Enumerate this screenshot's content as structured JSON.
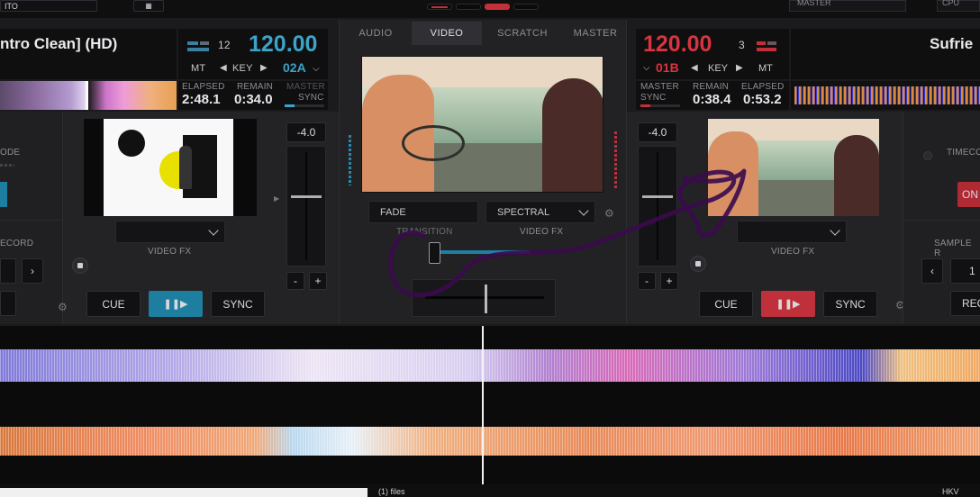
{
  "top_bar": {
    "left_label": "ITO",
    "right_master_label": "MASTER",
    "right_cpu_label": "CPU"
  },
  "left_deck": {
    "title": "ntro Clean] (HD)",
    "bpm": "120.00",
    "beat_count": "12",
    "key": "02A",
    "mt_label": "MT",
    "key_label": "KEY",
    "elapsed_label": "ELAPSED",
    "remain_label": "REMAIN",
    "master_label": "MASTER",
    "sync_label": "SYNC",
    "elapsed": "2:48.1",
    "remain": "0:34.0",
    "mode_label": "ODE",
    "record_label": "ECORD",
    "pitch": "-4.0",
    "video_fx_label": "VIDEO FX",
    "cue_label": "CUE",
    "sync_button_label": "SYNC",
    "minus_label": "-",
    "plus_label": "+",
    "accent_color": "#1d7ea0"
  },
  "center": {
    "tabs": [
      {
        "label": "AUDIO",
        "active": false
      },
      {
        "label": "VIDEO",
        "active": true
      },
      {
        "label": "SCRATCH",
        "active": false
      },
      {
        "label": "MASTER",
        "active": false
      }
    ],
    "transition_value": "FADE",
    "transition_label": "TRANSITION",
    "video_fx_value": "SPECTRAL",
    "video_fx_label": "VIDEO FX"
  },
  "right_deck": {
    "title": "Sufrie",
    "bpm": "120.00",
    "beat_count": "3",
    "key": "01B",
    "key_label": "KEY",
    "mt_label": "MT",
    "master_label": "MASTER",
    "sync_label": "SYNC",
    "remain_label": "REMAIN",
    "elapsed_label": "ELAPSED",
    "remain": "0:38.4",
    "elapsed": "0:53.2",
    "pitch": "-4.0",
    "video_fx_label": "VIDEO FX",
    "cue_label": "CUE",
    "sync_button_label": "SYNC",
    "minus_label": "-",
    "plus_label": "+",
    "timecode_label": "TIMECO",
    "on_label": "ON",
    "sample_label": "SAMPLE R",
    "sample_value": "1",
    "rec_label": "REC",
    "accent_color": "#c0303a"
  },
  "bottom": {
    "file_label": "(1) files",
    "right_label": "HKV"
  }
}
